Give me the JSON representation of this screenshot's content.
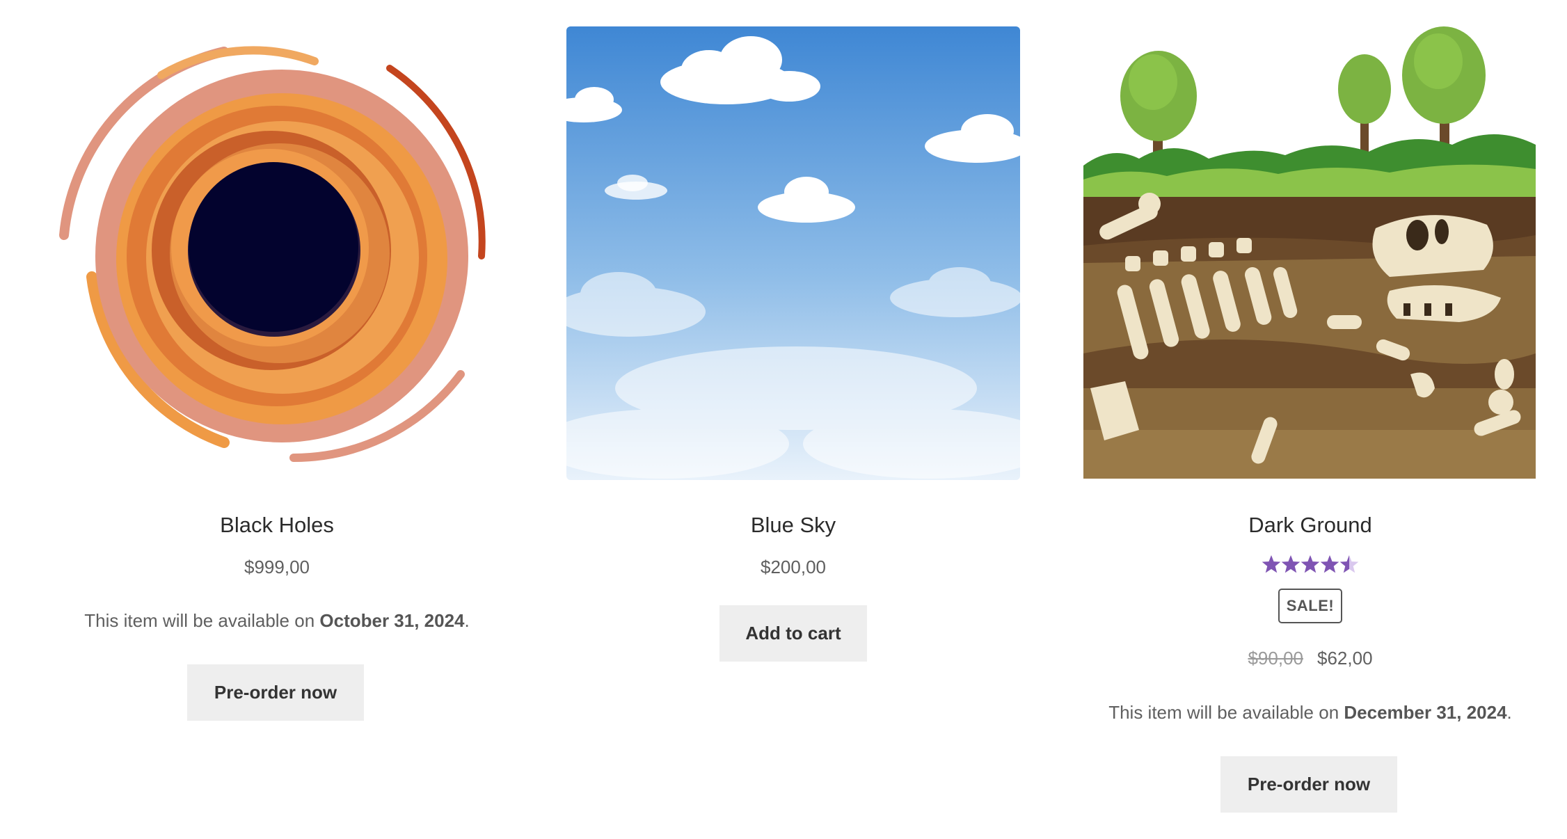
{
  "products": [
    {
      "name": "Black Holes",
      "price": "$999,00",
      "availability_prefix": "This item will be available on ",
      "availability_date": "October 31, 2024",
      "availability_suffix": ".",
      "button_label": "Pre-order now",
      "image_icon": "black-hole-image"
    },
    {
      "name": "Blue Sky",
      "price": "$200,00",
      "button_label": "Add to cart",
      "image_icon": "blue-sky-image"
    },
    {
      "name": "Dark Ground",
      "rating": 4.5,
      "rating_max": 5,
      "sale_badge": "SALE!",
      "regular_price": "$90,00",
      "sale_price": "$62,00",
      "availability_prefix": "This item will be available on ",
      "availability_date": "December 31, 2024",
      "availability_suffix": ".",
      "button_label": "Pre-order now",
      "image_icon": "dinosaur-fossil-ground-image"
    }
  ],
  "colors": {
    "star": "#7f54b3",
    "star_empty": "#d9c8ee",
    "button_bg": "#eeeeee",
    "text": "#333333",
    "muted": "#5f5f5f"
  }
}
